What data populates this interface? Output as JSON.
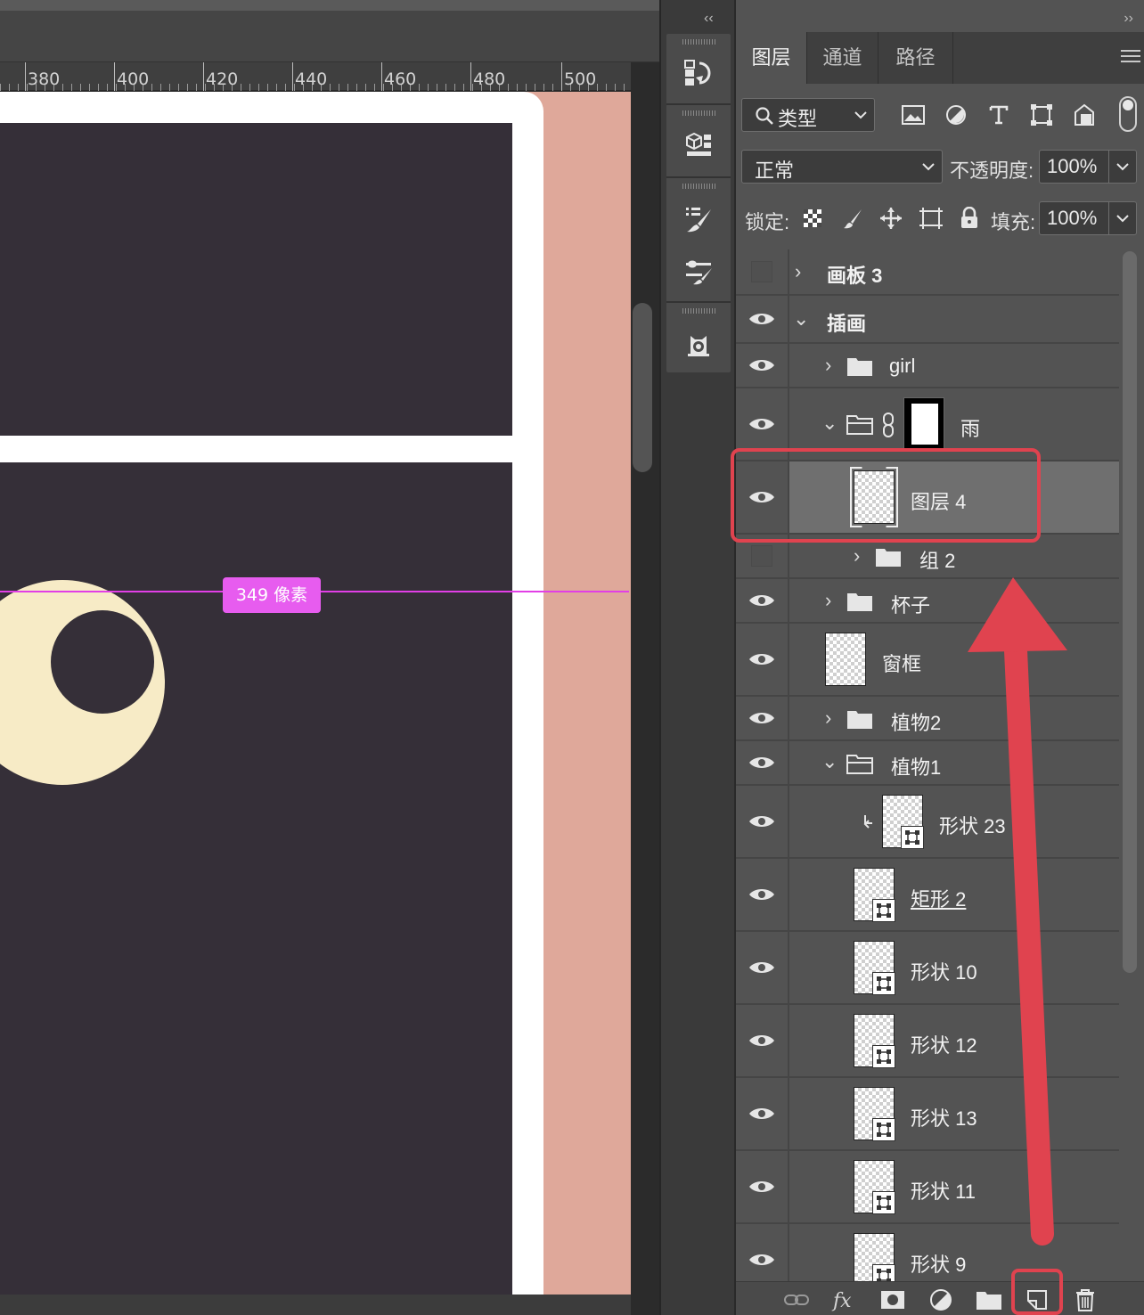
{
  "ruler": {
    "labels": [
      "380",
      "400",
      "420",
      "440",
      "460",
      "480",
      "500"
    ]
  },
  "canvas": {
    "measure_badge": "349 像素",
    "colors": {
      "canvas_bg": "#2b2b2b",
      "window_fill": "#352f38",
      "artboard_bg": "#dfa89a",
      "moon": "#f7ebc6",
      "guide": "#e23fe6"
    }
  },
  "dock": {
    "collapse_label": "‹‹"
  },
  "panel": {
    "collapse_label": "››",
    "tabs": [
      {
        "label": "图层",
        "active": true
      },
      {
        "label": "通道",
        "active": false
      },
      {
        "label": "路径",
        "active": false
      }
    ],
    "filter": {
      "selected": "类型",
      "icons": [
        "image-filter-icon",
        "adjustment-filter-icon",
        "type-filter-icon",
        "shape-filter-icon",
        "smart-object-filter-icon"
      ]
    },
    "blend_mode": "正常",
    "opacity": {
      "label": "不透明度:",
      "value": "100%"
    },
    "lock": {
      "label": "锁定:",
      "icons": [
        "lock-transparency-icon",
        "lock-image-icon",
        "lock-position-icon",
        "lock-artboard-icon",
        "lock-all-icon"
      ]
    },
    "fill": {
      "label": "填充:",
      "value": "100%"
    }
  },
  "layers": [
    {
      "name": "画板 3",
      "visible": false,
      "kind": "artboard",
      "expanded": false
    },
    {
      "name": "插画",
      "visible": true,
      "kind": "artboard",
      "expanded": true
    },
    {
      "name": "girl",
      "visible": true,
      "kind": "group",
      "expanded": false
    },
    {
      "name": "雨",
      "visible": true,
      "kind": "group-masked",
      "expanded": true
    },
    {
      "name": "图层 4",
      "visible": true,
      "kind": "pixel",
      "selected": true
    },
    {
      "name": "组 2",
      "visible": false,
      "kind": "group",
      "expanded": false
    },
    {
      "name": "杯子",
      "visible": true,
      "kind": "group",
      "expanded": false
    },
    {
      "name": "窗框",
      "visible": true,
      "kind": "pixel"
    },
    {
      "name": "植物2",
      "visible": true,
      "kind": "group",
      "expanded": false
    },
    {
      "name": "植物1",
      "visible": true,
      "kind": "group",
      "expanded": true
    },
    {
      "name": "形状 23",
      "visible": true,
      "kind": "shape",
      "clipped": true
    },
    {
      "name": "矩形 2",
      "visible": true,
      "kind": "shape"
    },
    {
      "name": "形状 10",
      "visible": true,
      "kind": "shape"
    },
    {
      "name": "形状 12",
      "visible": true,
      "kind": "shape"
    },
    {
      "name": "形状 13",
      "visible": true,
      "kind": "shape"
    },
    {
      "name": "形状 11",
      "visible": true,
      "kind": "shape"
    },
    {
      "name": "形状 9",
      "visible": true,
      "kind": "shape"
    }
  ],
  "bottom_bar": [
    "link-layers-icon",
    "fx-icon",
    "add-mask-icon",
    "adjustment-layer-icon",
    "new-group-icon",
    "new-layer-icon",
    "delete-layer-icon"
  ],
  "annotation": {
    "color": "#e0434f"
  }
}
